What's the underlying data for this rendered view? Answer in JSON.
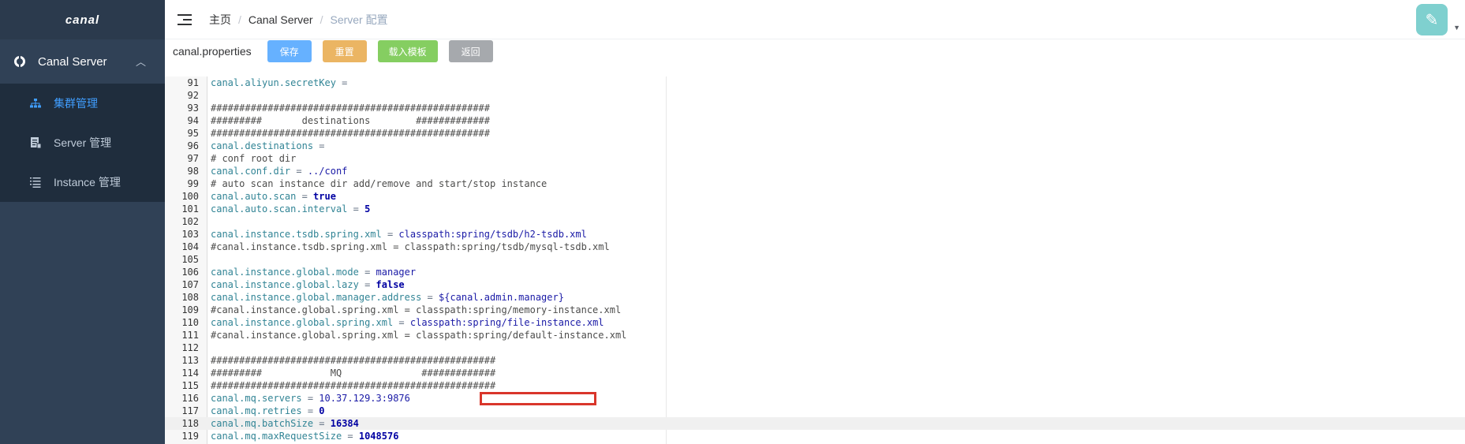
{
  "sidebar": {
    "logo": "canal",
    "group": {
      "label": "Canal Server",
      "icon": "pie-chart-icon"
    },
    "items": [
      {
        "label": "集群管理",
        "icon": "cluster-icon",
        "active": true
      },
      {
        "label": "Server 管理",
        "icon": "server-doc-icon",
        "active": false
      },
      {
        "label": "Instance 管理",
        "icon": "list-icon",
        "active": false
      }
    ]
  },
  "breadcrumb": [
    "主页",
    "Canal Server",
    "Server 配置"
  ],
  "toolbar": {
    "file": "canal.properties",
    "save": "保存",
    "reset": "重置",
    "load_template": "载入模板",
    "back": "返回"
  },
  "editor": {
    "lines": [
      {
        "n": "91",
        "code": "canal.aliyun.secretKey ="
      },
      {
        "n": "92",
        "code": ""
      },
      {
        "n": "93",
        "code": "#################################################"
      },
      {
        "n": "94",
        "code": "#########       destinations        #############"
      },
      {
        "n": "95",
        "code": "#################################################"
      },
      {
        "n": "96",
        "code": "canal.destinations ="
      },
      {
        "n": "97",
        "code": "# conf root dir"
      },
      {
        "n": "98",
        "code": "canal.conf.dir = ../conf"
      },
      {
        "n": "99",
        "code": "# auto scan instance dir add/remove and start/stop instance"
      },
      {
        "n": "100",
        "code": "canal.auto.scan = true"
      },
      {
        "n": "101",
        "code": "canal.auto.scan.interval = 5"
      },
      {
        "n": "102",
        "code": ""
      },
      {
        "n": "103",
        "code": "canal.instance.tsdb.spring.xml = classpath:spring/tsdb/h2-tsdb.xml"
      },
      {
        "n": "104",
        "code": "#canal.instance.tsdb.spring.xml = classpath:spring/tsdb/mysql-tsdb.xml"
      },
      {
        "n": "105",
        "code": ""
      },
      {
        "n": "106",
        "code": "canal.instance.global.mode = manager"
      },
      {
        "n": "107",
        "code": "canal.instance.global.lazy = false"
      },
      {
        "n": "108",
        "code": "canal.instance.global.manager.address = ${canal.admin.manager}"
      },
      {
        "n": "109",
        "code": "#canal.instance.global.spring.xml = classpath:spring/memory-instance.xml"
      },
      {
        "n": "110",
        "code": "canal.instance.global.spring.xml = classpath:spring/file-instance.xml"
      },
      {
        "n": "111",
        "code": "#canal.instance.global.spring.xml = classpath:spring/default-instance.xml"
      },
      {
        "n": "112",
        "code": ""
      },
      {
        "n": "113",
        "code": "##################################################"
      },
      {
        "n": "114",
        "code": "#########            MQ              #############"
      },
      {
        "n": "115",
        "code": "##################################################"
      },
      {
        "n": "116",
        "code": "canal.mq.servers = 10.37.129.3:9876"
      },
      {
        "n": "117",
        "code": "canal.mq.retries = 0"
      },
      {
        "n": "118",
        "code": "canal.mq.batchSize = 16384"
      },
      {
        "n": "119",
        "code": "canal.mq.maxRequestSize = 1048576"
      }
    ],
    "current_line": "118",
    "highlighted_line": "116"
  }
}
